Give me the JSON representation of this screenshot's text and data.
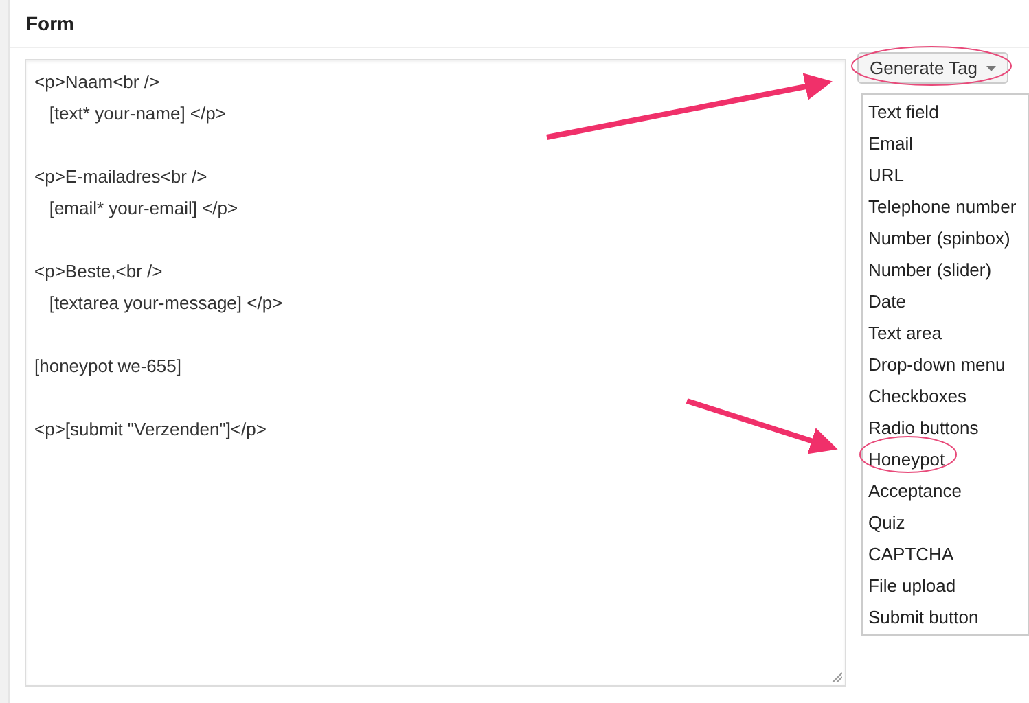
{
  "section": {
    "title": "Form"
  },
  "editor": {
    "paragraphs": [
      [
        "<p>Naam<br />",
        "   [text* your-name] </p>"
      ],
      [
        "<p>E-mailadres<br />",
        "   [email* your-email] </p>"
      ],
      [
        "<p>Beste,<br />",
        "   [textarea your-message] </p>"
      ],
      [
        "[honeypot we-655]"
      ],
      [
        "<p>[submit \"Verzenden\"]</p>"
      ]
    ]
  },
  "generate_tag": {
    "label": "Generate Tag",
    "menu": [
      "Text field",
      "Email",
      "URL",
      "Telephone number",
      "Number (spinbox)",
      "Number (slider)",
      "Date",
      "Text area",
      "Drop-down menu",
      "Checkboxes",
      "Radio buttons",
      "Honeypot",
      "Acceptance",
      "Quiz",
      "CAPTCHA",
      "File upload",
      "Submit button"
    ]
  }
}
